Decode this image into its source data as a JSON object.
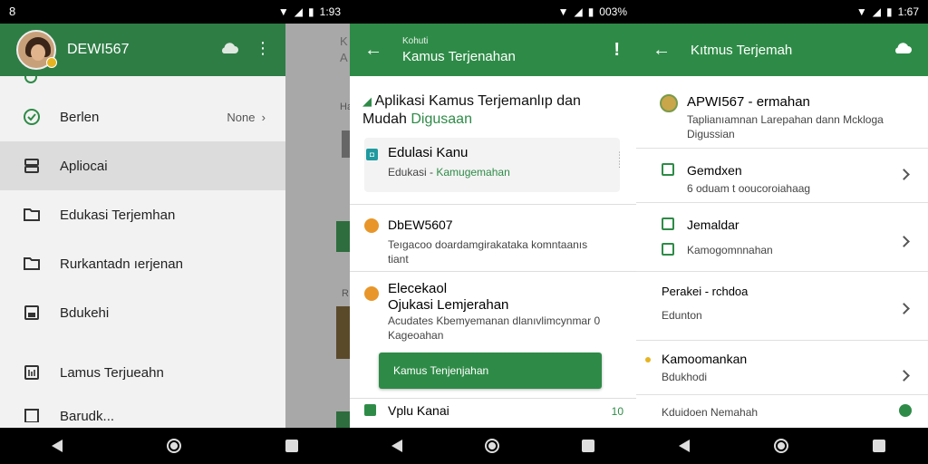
{
  "screen1": {
    "status_time": "1:93",
    "status_left": "8",
    "profile_name": "DEWI567",
    "menu_items": [
      {
        "label": "Berlen",
        "trailing": "None"
      },
      {
        "label": "Apliocai"
      },
      {
        "label": "Edukasi Terjemhan"
      },
      {
        "label": "Rurkantadn ıerjenan"
      },
      {
        "label": "Bdukehi"
      },
      {
        "label": "Lamus Terjueahn"
      },
      {
        "label": "Barudk..."
      }
    ],
    "behind_text_1": "K",
    "behind_text_2": "A",
    "behind_text_3": "Ha",
    "behind_text_4": "R"
  },
  "screen2": {
    "status_time": "003%",
    "appbar_subtitle": "Kohuti",
    "appbar_title": "Kamus Terjenahan",
    "heading_line1": "Aplikasi Kamus Terjemanlıp dan",
    "heading_line2_prefix": "Mudah ",
    "heading_line2_green": "Digusaan",
    "card1_title": "Edulasi Kanu",
    "card1_sub_prefix": "Edukasi - ",
    "card1_sub_green": "Kamugemahan",
    "card2_title": "DbEW5607",
    "card2_desc_1": "Teıgacoo doardamgirakataka komntaanıs",
    "card2_desc_2": "tiant",
    "card3_title_1": "Elecekaol",
    "card3_title_2": "Ojukasi Lemjerahan",
    "card3_desc_1": "Acudates Kbemyemanan dlanıvlimcynmar 0",
    "card3_desc_2": "Kageoahan",
    "button_label": "Kamus Tenjenjahan",
    "bottom_title": "Vplu Kanai",
    "bottom_trail": "10"
  },
  "screen3": {
    "status_time": "1:67",
    "appbar_title": "Kıtmus Terjemah",
    "row1_title": "APWI567 - ermahan",
    "row1_desc_1": "Taplianıamnan Larepahan dann Mckloga",
    "row1_desc_2": "Digussian",
    "row2_title": "Gemdxen",
    "row2_sub": "6 oduam t ooucoroiahaag",
    "row3_title": "Jemaldar",
    "row3_sub": "Kamogomnnahan",
    "row4_title": "Perakei - rchdoa",
    "row4_sub": "Edunton",
    "row5_title": "Kamoomankan",
    "row5_sub": "Bdukhodi",
    "row6_title": "Kduidoen Nemahah"
  },
  "colors": {
    "primary_green": "#2e8b47",
    "accent_yellow": "#e6b422",
    "accent_orange": "#e8962a"
  }
}
